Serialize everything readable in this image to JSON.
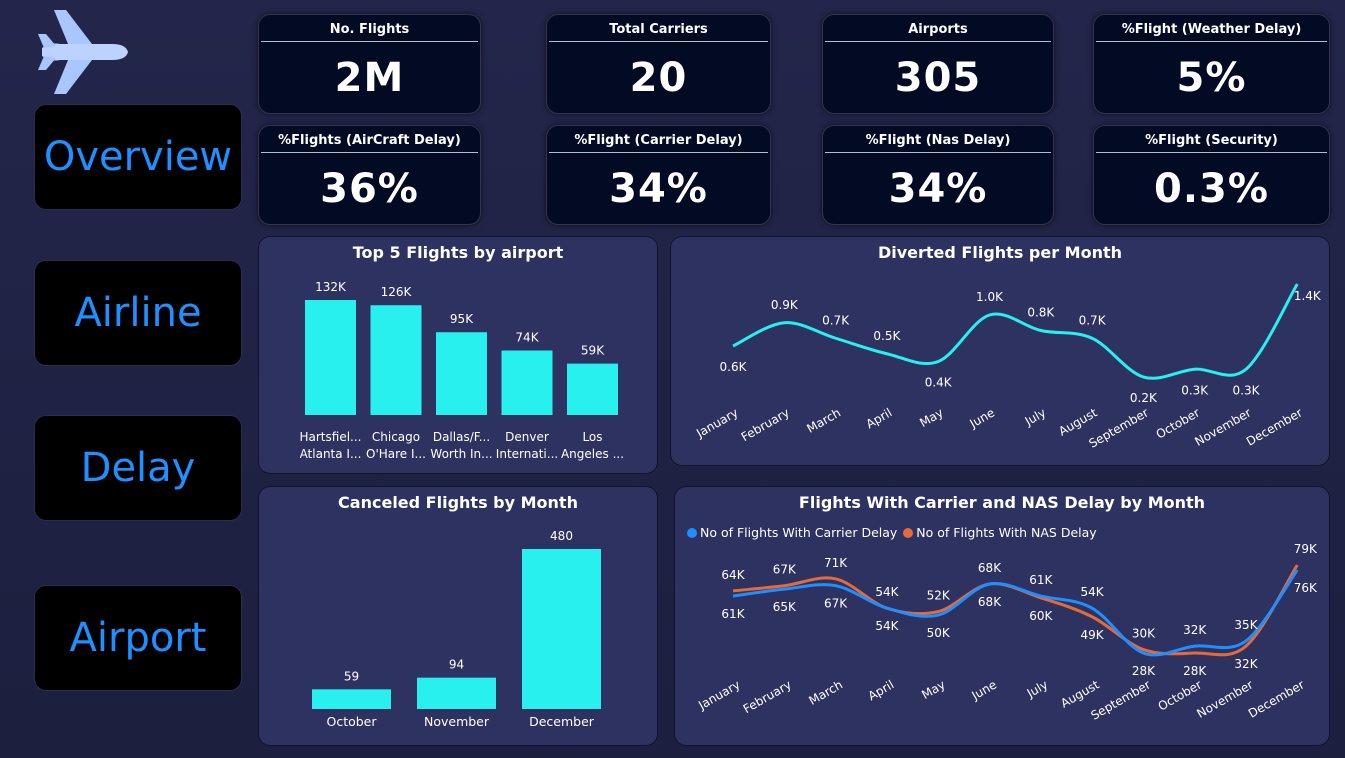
{
  "nav": {
    "overview": "Overview",
    "airline": "Airline",
    "delay": "Delay",
    "airport": "Airport"
  },
  "kpis": [
    {
      "title": "No. Flights",
      "value": "2M"
    },
    {
      "title": "Total Carriers",
      "value": "20"
    },
    {
      "title": "Airports",
      "value": "305"
    },
    {
      "title": "%Flight (Weather Delay)",
      "value": "5%"
    },
    {
      "title": "%Flights (AirCraft Delay)",
      "value": "36%"
    },
    {
      "title": "%Flight (Carrier Delay)",
      "value": "34%"
    },
    {
      "title": "%Flight (Nas Delay)",
      "value": "34%"
    },
    {
      "title": "%Flight (Security)",
      "value": "0.3%"
    }
  ],
  "colors": {
    "bar": "#27f0ee",
    "carrier": "#1f8fff",
    "nas": "#e56a3b",
    "nav_text": "#1e90ff"
  },
  "chart_data": [
    {
      "type": "bar",
      "title": "Top 5 Flights by airport",
      "categories": [
        "Hartsfiel... Atlanta I...",
        "Chicago O'Hare I...",
        "Dallas/F... Worth In...",
        "Denver Internati...",
        "Los Angeles ..."
      ],
      "category_lines": [
        [
          "Hartsfiel...",
          "Atlanta I..."
        ],
        [
          "Chicago",
          "O'Hare I..."
        ],
        [
          "Dallas/F...",
          "Worth In..."
        ],
        [
          "Denver",
          "Internati..."
        ],
        [
          "Los",
          "Angeles ..."
        ]
      ],
      "values": [
        132000,
        126000,
        95000,
        74000,
        59000
      ],
      "labels": [
        "132K",
        "126K",
        "95K",
        "74K",
        "59K"
      ]
    },
    {
      "type": "line",
      "title": "Diverted Flights per Month",
      "categories": [
        "January",
        "February",
        "March",
        "April",
        "May",
        "June",
        "July",
        "August",
        "September",
        "October",
        "November",
        "December"
      ],
      "values": [
        0.6,
        0.9,
        0.7,
        0.5,
        0.4,
        1.0,
        0.8,
        0.7,
        0.2,
        0.3,
        0.3,
        1.4
      ],
      "labels": [
        "0.6K",
        "0.9K",
        "0.7K",
        "0.5K",
        "0.4K",
        "1.0K",
        "0.8K",
        "0.7K",
        "0.2K",
        "0.3K",
        "0.3K",
        "1.4K"
      ],
      "unit": "K"
    },
    {
      "type": "bar",
      "title": "Canceled Flights by Month",
      "categories": [
        "October",
        "November",
        "December"
      ],
      "values": [
        59,
        94,
        480
      ],
      "labels": [
        "59",
        "94",
        "480"
      ]
    },
    {
      "type": "line",
      "title": "Flights With Carrier and NAS Delay by Month",
      "categories": [
        "January",
        "February",
        "March",
        "April",
        "May",
        "June",
        "July",
        "August",
        "September",
        "October",
        "November",
        "December"
      ],
      "series": [
        {
          "name": "No of Flights With Carrier Delay",
          "values": [
            61,
            65,
            67,
            54,
            50,
            68,
            61,
            54,
            28,
            32,
            35,
            76
          ],
          "labels": [
            "61K",
            "65K",
            "67K",
            "54K",
            "50K",
            "68K",
            "61K",
            "54K",
            "28K",
            "32K",
            "35K",
            "76K"
          ]
        },
        {
          "name": "No of Flights With NAS Delay",
          "values": [
            64,
            67,
            71,
            54,
            52,
            68,
            60,
            49,
            30,
            28,
            32,
            79
          ],
          "labels": [
            "64K",
            "67K",
            "71K",
            "54K",
            "52K",
            "68K",
            "60K",
            "49K",
            "30K",
            "28K",
            "32K",
            "79K"
          ]
        }
      ],
      "unit": "K"
    }
  ]
}
